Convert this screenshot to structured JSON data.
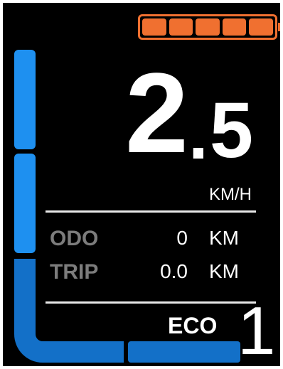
{
  "battery": {
    "level_bars": 5,
    "filled_bars": 5,
    "color": "#f07030"
  },
  "assist_bars": {
    "color_bright": "#1e90f0",
    "color_dim": "#1370c8"
  },
  "speed": {
    "integer": "2",
    "separator": ".",
    "decimal": "5",
    "unit": "KM/H"
  },
  "stats": {
    "odo": {
      "label": "ODO",
      "value": "0",
      "unit": "KM"
    },
    "trip": {
      "label": "TRIP",
      "value": "0.0",
      "unit": "KM"
    }
  },
  "mode": {
    "label": "ECO",
    "level": "1"
  }
}
